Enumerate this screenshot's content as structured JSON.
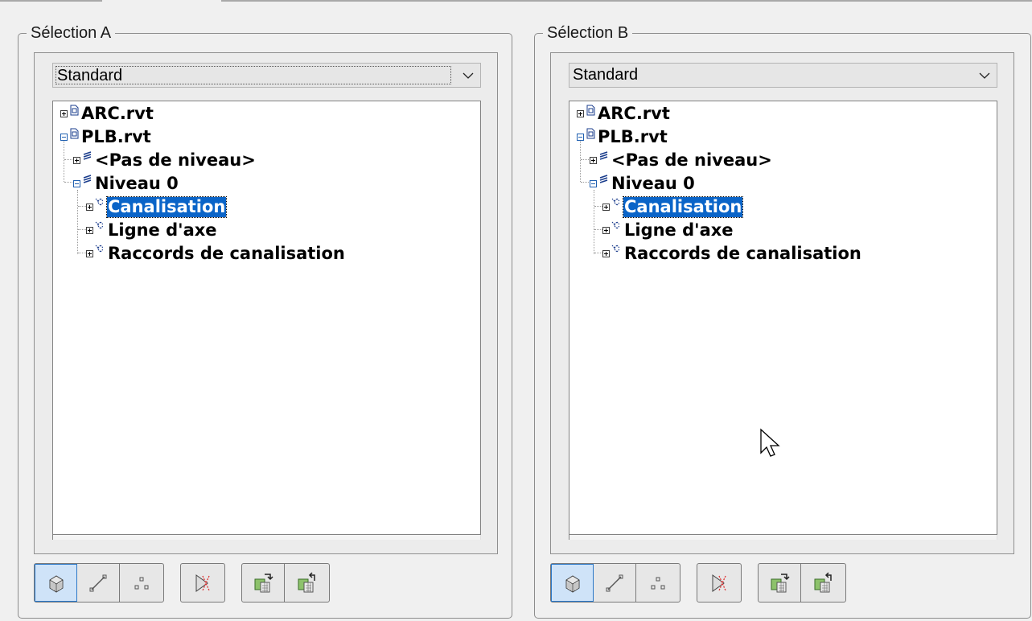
{
  "panels": [
    {
      "title": "Sélection A",
      "dropdown_value": "Standard",
      "tree": [
        {
          "label": "ARC.rvt",
          "state": "collapsed",
          "kind": "file-icon"
        },
        {
          "label": "PLB.rvt",
          "state": "expanded",
          "kind": "file-icon"
        },
        {
          "label": "<Pas de niveau>",
          "state": "collapsed",
          "kind": "level-icon"
        },
        {
          "label": "Niveau 0",
          "state": "expanded",
          "kind": "level-icon"
        },
        {
          "label": "Canalisation",
          "state": "collapsed",
          "kind": "category-icon",
          "selected": true
        },
        {
          "label": "Ligne d'axe",
          "state": "collapsed",
          "kind": "category-icon"
        },
        {
          "label": "Raccords de canalisation",
          "state": "collapsed",
          "kind": "category-icon"
        }
      ],
      "toolbar": [
        {
          "name": "select-geometry-button",
          "icon": "cube-icon",
          "active": true
        },
        {
          "name": "select-lines-button",
          "icon": "line-icon",
          "active": false
        },
        {
          "name": "select-points-button",
          "icon": "points-icon",
          "active": false
        },
        {
          "name": "clear-selection-button",
          "icon": "clear-selection-icon",
          "active": false
        },
        {
          "name": "save-selection-button",
          "icon": "save-set-icon",
          "active": false
        },
        {
          "name": "load-selection-button",
          "icon": "load-set-icon",
          "active": false
        }
      ]
    },
    {
      "title": "Sélection B",
      "dropdown_value": "Standard",
      "tree": [
        {
          "label": "ARC.rvt",
          "state": "collapsed",
          "kind": "file-icon"
        },
        {
          "label": "PLB.rvt",
          "state": "expanded",
          "kind": "file-icon"
        },
        {
          "label": "<Pas de niveau>",
          "state": "collapsed",
          "kind": "level-icon"
        },
        {
          "label": "Niveau 0",
          "state": "expanded",
          "kind": "level-icon"
        },
        {
          "label": "Canalisation",
          "state": "collapsed",
          "kind": "category-icon",
          "selected": true
        },
        {
          "label": "Ligne d'axe",
          "state": "collapsed",
          "kind": "category-icon"
        },
        {
          "label": "Raccords de canalisation",
          "state": "collapsed",
          "kind": "category-icon"
        }
      ],
      "toolbar": [
        {
          "name": "select-geometry-button",
          "icon": "cube-icon",
          "active": true
        },
        {
          "name": "select-lines-button",
          "icon": "line-icon",
          "active": false
        },
        {
          "name": "select-points-button",
          "icon": "points-icon",
          "active": false
        },
        {
          "name": "clear-selection-button",
          "icon": "clear-selection-icon",
          "active": false
        },
        {
          "name": "save-selection-button",
          "icon": "save-set-icon",
          "active": false
        },
        {
          "name": "load-selection-button",
          "icon": "load-set-icon",
          "active": false
        }
      ]
    }
  ],
  "colors": {
    "selection_highlight": "#0a64c8",
    "active_button": "#cfe3f8",
    "background": "#f0f0f0"
  }
}
